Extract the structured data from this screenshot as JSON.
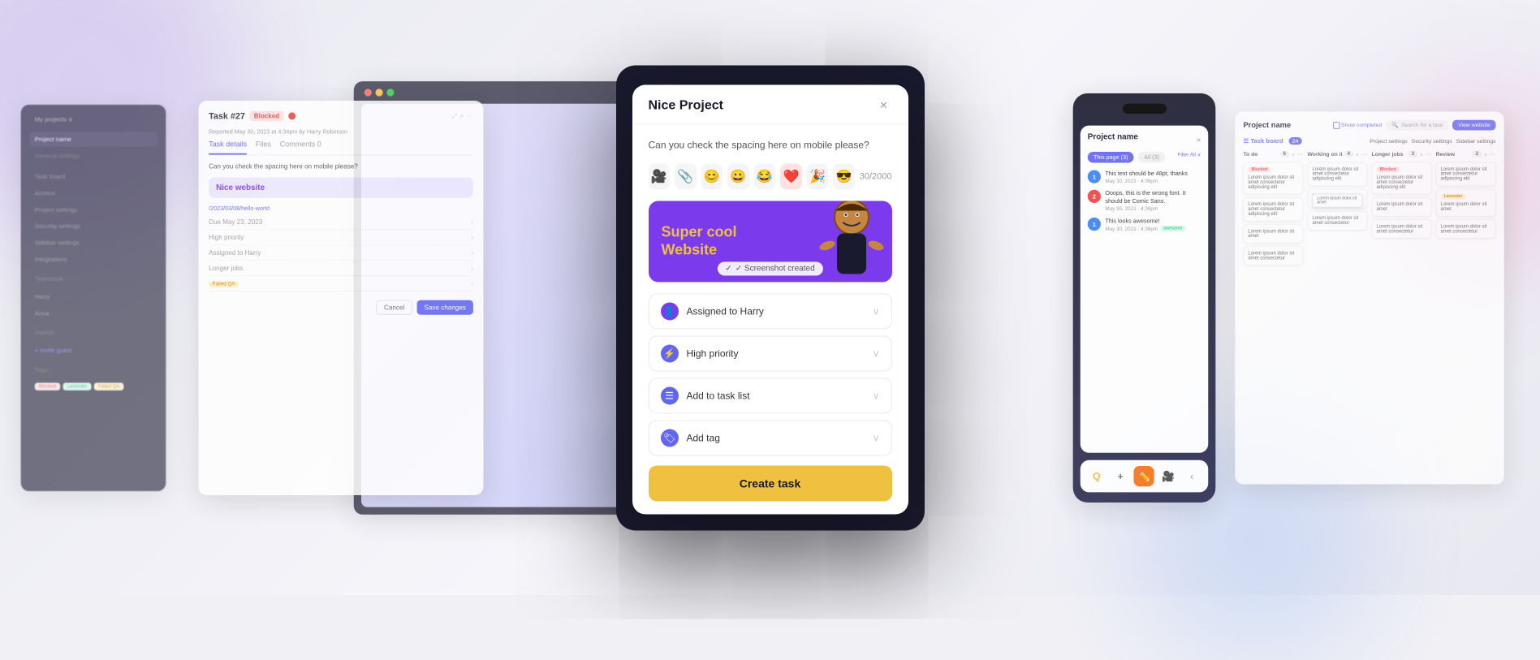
{
  "scene": {
    "background": "#f0f0f5"
  },
  "modal": {
    "title": "Nice Project",
    "close_label": "×",
    "description": "Can you check the spacing here on mobile please?",
    "emoji_toolbar": {
      "emojis": [
        "🎥",
        "📎",
        "😊",
        "😀",
        "😂",
        "❤️",
        "🎉",
        "😎"
      ],
      "count_label": "30/2000"
    },
    "preview": {
      "title_line1": "Super cool",
      "title_line2": "Website",
      "character": "🧑",
      "screenshot_label": "✓ Screenshot created"
    },
    "dropdowns": [
      {
        "icon": "👤",
        "icon_type": "user",
        "label": "Assigned to Harry",
        "id": "assign"
      },
      {
        "icon": "⚡",
        "icon_type": "priority",
        "label": "High priority",
        "id": "priority"
      },
      {
        "icon": "☰",
        "icon_type": "list",
        "label": "Add to task list",
        "id": "tasklist"
      },
      {
        "icon": "🏷",
        "icon_type": "tag",
        "label": "Add tag",
        "id": "tag"
      }
    ],
    "create_button": "Create task"
  },
  "left_task_card": {
    "task_number": "Task #27",
    "badge": "Blocked",
    "reporter": "Reported May 30, 2023 at 4:34pm by Harry Robinson",
    "tabs": [
      "Task details",
      "Files",
      "Comments 0"
    ],
    "active_tab": "Task details",
    "description": "Can you check the spacing here on mobile please?",
    "attachment_title": "Nice website",
    "url": "/2023/03/08/hello-world",
    "fields": [
      {
        "label": "Due May 23, 2023",
        "value": ""
      },
      {
        "label": "High priority",
        "value": ""
      },
      {
        "label": "Assigned to Harry",
        "value": ""
      },
      {
        "label": "Longer jobs",
        "value": ""
      },
      {
        "label": "Failed QA",
        "value": ""
      }
    ],
    "cancel_btn": "Cancel",
    "save_btn": "Save changes"
  },
  "mobile_card": {
    "project_title": "Project name",
    "tabs": [
      "This page (3)",
      "All (3)"
    ],
    "filter_label": "Filter All",
    "comments": [
      {
        "avatar_num": 1,
        "avatar_color": "#3b82f6",
        "text": "This text should be 48pt, thanks",
        "time": "May 30, 2023 · 4:36pm"
      },
      {
        "avatar_num": 2,
        "avatar_color": "#ef4444",
        "text": "Ooops, this is the wrong font. It should be Comic Sans.",
        "time": "May 30, 2023 · 4:36pm"
      },
      {
        "avatar_num": 1,
        "avatar_color": "#3b82f6",
        "text": "This looks awesome!",
        "time": "May 30, 2023 · 4:36pm"
      }
    ],
    "bottom_icons": [
      "Q",
      "+",
      "✏️",
      "🎥",
      "‹"
    ]
  },
  "right_kanban": {
    "title": "Project name",
    "show_completed_label": "Show completed",
    "search_placeholder": "Search for a task",
    "view_website_label": "View website",
    "columns": [
      {
        "title": "To do",
        "count": 6,
        "cards": [
          {
            "text": "Lorem ipsum dolor sit amet consectetur adipiscing elit",
            "badge": null
          },
          {
            "text": "Lorem ipsum dolor sit amet consectetur adipiscing elit",
            "badge": "Blocked"
          },
          {
            "text": "Lorem ipsum dolor sit amet",
            "badge": null
          }
        ]
      },
      {
        "title": "Working on it",
        "count": 4,
        "cards": [
          {
            "text": "Lorem ipsum dolor sit amet consectetur adipiscing elit",
            "badge": null
          },
          {
            "text": "Lorem ipsum dolor sit amet",
            "badge": null
          }
        ]
      },
      {
        "title": "Longer jobs",
        "count": 3,
        "cards": [
          {
            "text": "Lorem ipsum dolor sit amet consectetur adipiscing elit",
            "badge": "Blocked"
          }
        ]
      },
      {
        "title": "Review",
        "count": 2,
        "cards": [
          {
            "text": "Lorem ipsum dolor sit amet consectetur adipiscing elit",
            "badge": "Lavender"
          }
        ]
      }
    ]
  }
}
